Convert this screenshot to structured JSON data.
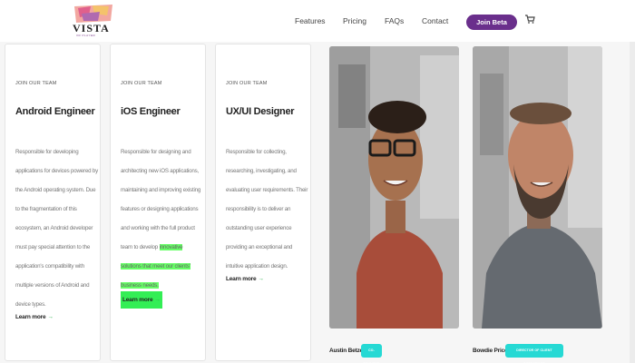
{
  "brand": {
    "name": "VISTA",
    "tagline": "VR PLAYER"
  },
  "nav": {
    "items": [
      "Features",
      "Pricing",
      "FAQs",
      "Contact"
    ],
    "cta_label": "Join Beta",
    "cta_color": "#6a2f8c"
  },
  "jobs": [
    {
      "eyebrow": "JOIN OUR TEAM",
      "title": "Android Engineer",
      "description": "Responsible for developing applications for devices powered by the Android operating system. Due to the fragmentation of this ecosystem, an Android developer must pay special attention to the application's compatibility with multiple versions of Android and device types.",
      "link": "Learn more"
    },
    {
      "eyebrow": "JOIN OUR TEAM",
      "title": "iOS Engineer",
      "description_main": "Responsible for designing and architecting new iOS applications, maintaining and improving existing features or designing applications and working with the full product team to develop",
      "description_highlight": "innovative solutions that meet our clients' business needs.",
      "link": "Learn more"
    },
    {
      "eyebrow": "JOIN OUR TEAM",
      "title": "UX/UI Designer",
      "description": "Responsible for collecting, researching, investigating, and evaluating user requirements. Their responsibility is to deliver an outstanding user experience providing an exceptional and intuitive application design.",
      "link": "Learn more"
    }
  ],
  "team": [
    {
      "name": "Austin Betzer",
      "role": "CO-FOUNDER"
    },
    {
      "name": "Bowdie Price",
      "role": "DIRECTOR OF CLIENT OPERATIONS"
    }
  ],
  "colors": {
    "accent_teal": "#26d9d4",
    "highlight_green": "#66ff66"
  }
}
